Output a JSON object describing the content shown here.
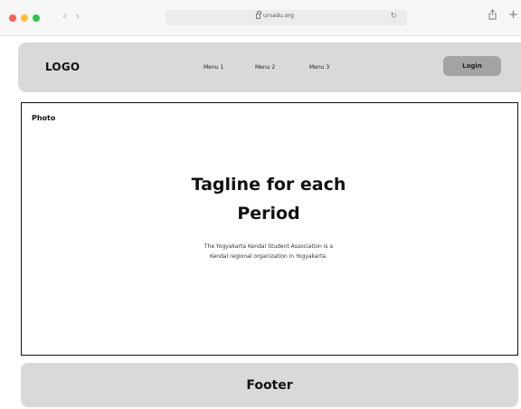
{
  "browser": {
    "url": "urnadu.org",
    "back_icon": "chevron-left-icon",
    "forward_icon": "chevron-right-icon",
    "reload_icon": "reload-icon",
    "share_icon": "share-icon",
    "new_tab_icon": "plus-icon",
    "traffic_colors": {
      "close": "#fe5f57",
      "minimize": "#febc2e",
      "zoom": "#28c840"
    }
  },
  "header": {
    "logo": "LOGO",
    "menu": [
      "Menu 1",
      "Menu 2",
      "Menu 3"
    ],
    "login_label": "Login",
    "background": "#d9d9d9",
    "login_background": "#a3a3a3"
  },
  "hero": {
    "photo_label": "Photo",
    "tagline_line1": "Tagline for each",
    "tagline_line2": "Period",
    "description_line1": "The Yogyakarta Kendal Student Association is a",
    "description_line2": "Kendal regional organization in Yogyakarta."
  },
  "footer": {
    "label": "Footer",
    "background": "#d9d9d9"
  }
}
